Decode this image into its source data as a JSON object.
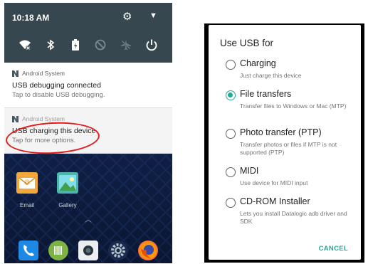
{
  "status_bar": {
    "time": "10:18 AM"
  },
  "quick_settings": {
    "icons": [
      "wifi-off-icon",
      "bluetooth-icon",
      "battery-charging-icon",
      "do-not-disturb-icon",
      "airplane-mode-icon",
      "power-icon"
    ]
  },
  "notifications": [
    {
      "app": "Android System",
      "title": "USB debugging connected",
      "subtitle": "Tap to disable USB debugging."
    },
    {
      "app": "Android System",
      "title": "USB charging this device",
      "subtitle": "Tap for more options."
    }
  ],
  "home": {
    "apps": [
      {
        "label": "Email"
      },
      {
        "label": "Gallery"
      }
    ],
    "dock": [
      "phone-icon",
      "scanner-icon",
      "camera-icon",
      "settings-icon",
      "firefox-icon"
    ]
  },
  "dialog": {
    "title": "Use USB for",
    "options": [
      {
        "label": "Charging",
        "description": "Just charge this device",
        "selected": false
      },
      {
        "label": "File transfers",
        "description": "Transfer files to Windows or Mac (MTP)",
        "selected": true
      },
      {
        "label": "Photo transfer (PTP)",
        "description": "Transfer photos or files if MTP is not supported (PTP)",
        "selected": false
      },
      {
        "label": "MIDI",
        "description": "Use device for MIDI input",
        "selected": false
      },
      {
        "label": "CD-ROM Installer",
        "description": "Lets you install Datalogic adb driver and SDK",
        "selected": false
      }
    ],
    "cancel_label": "CANCEL"
  },
  "colors": {
    "accent": "#26a69a",
    "highlight": "#e21b1b",
    "header": "#37474f"
  }
}
